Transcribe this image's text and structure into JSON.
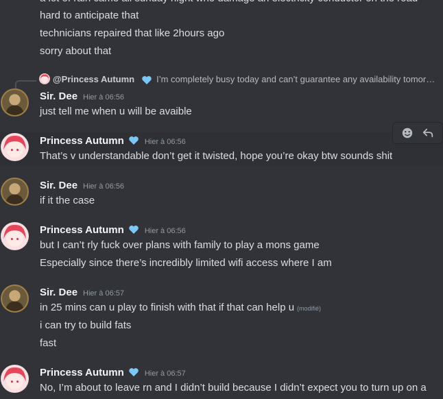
{
  "messages_top": {
    "line1": "a lot of rain came all sunday night who damage an electricity conductor on the road",
    "line2": "hard to anticipate that",
    "line3": "technicians repaired that like 2hours ago",
    "line4": "sorry about that"
  },
  "reply": {
    "name": "@Princess Autumn",
    "text": "I’m completely busy today and can’t guarantee any availability tomor…"
  },
  "groups": [
    {
      "author": "Sir. Dee",
      "time": "Hier à 06:56",
      "lines": [
        "just tell me when u will be avaible"
      ]
    },
    {
      "author": "Princess Autumn",
      "time": "Hier à 06:56",
      "lines": [
        "That’s v understandable don’t get it twisted, hope you’re okay btw sounds shit"
      ]
    },
    {
      "author": "Sir. Dee",
      "time": "Hier à 06:56",
      "lines": [
        "if it the case"
      ]
    },
    {
      "author": "Princess Autumn",
      "time": "Hier à 06:56",
      "lines": [
        "but I can’t rly fuck over plans with family to play a mons game",
        "Especially since there’s incredibly limited wifi access where I am"
      ]
    },
    {
      "author": "Sir. Dee",
      "time": "Hier à 06:57",
      "lines": [
        "in 25 mins can u play to finish with that if that can help u",
        "i can try to build fats",
        "fast"
      ],
      "edited": "(modifié)"
    },
    {
      "author": "Princess Autumn",
      "time": "Hier à 06:57",
      "lines": [
        "No, I’m about to leave rn and I didn’t build because I didn’t expect you to turn up on a"
      ]
    }
  ],
  "colors": {
    "background": "#313338",
    "hover": "#2e3035",
    "heart": "#7bc8f6",
    "text": "#dbdee1",
    "muted": "#949ba4"
  },
  "icons": {
    "heart": "blue-heart-icon",
    "react": "add-reaction-icon",
    "reply": "reply-icon"
  }
}
